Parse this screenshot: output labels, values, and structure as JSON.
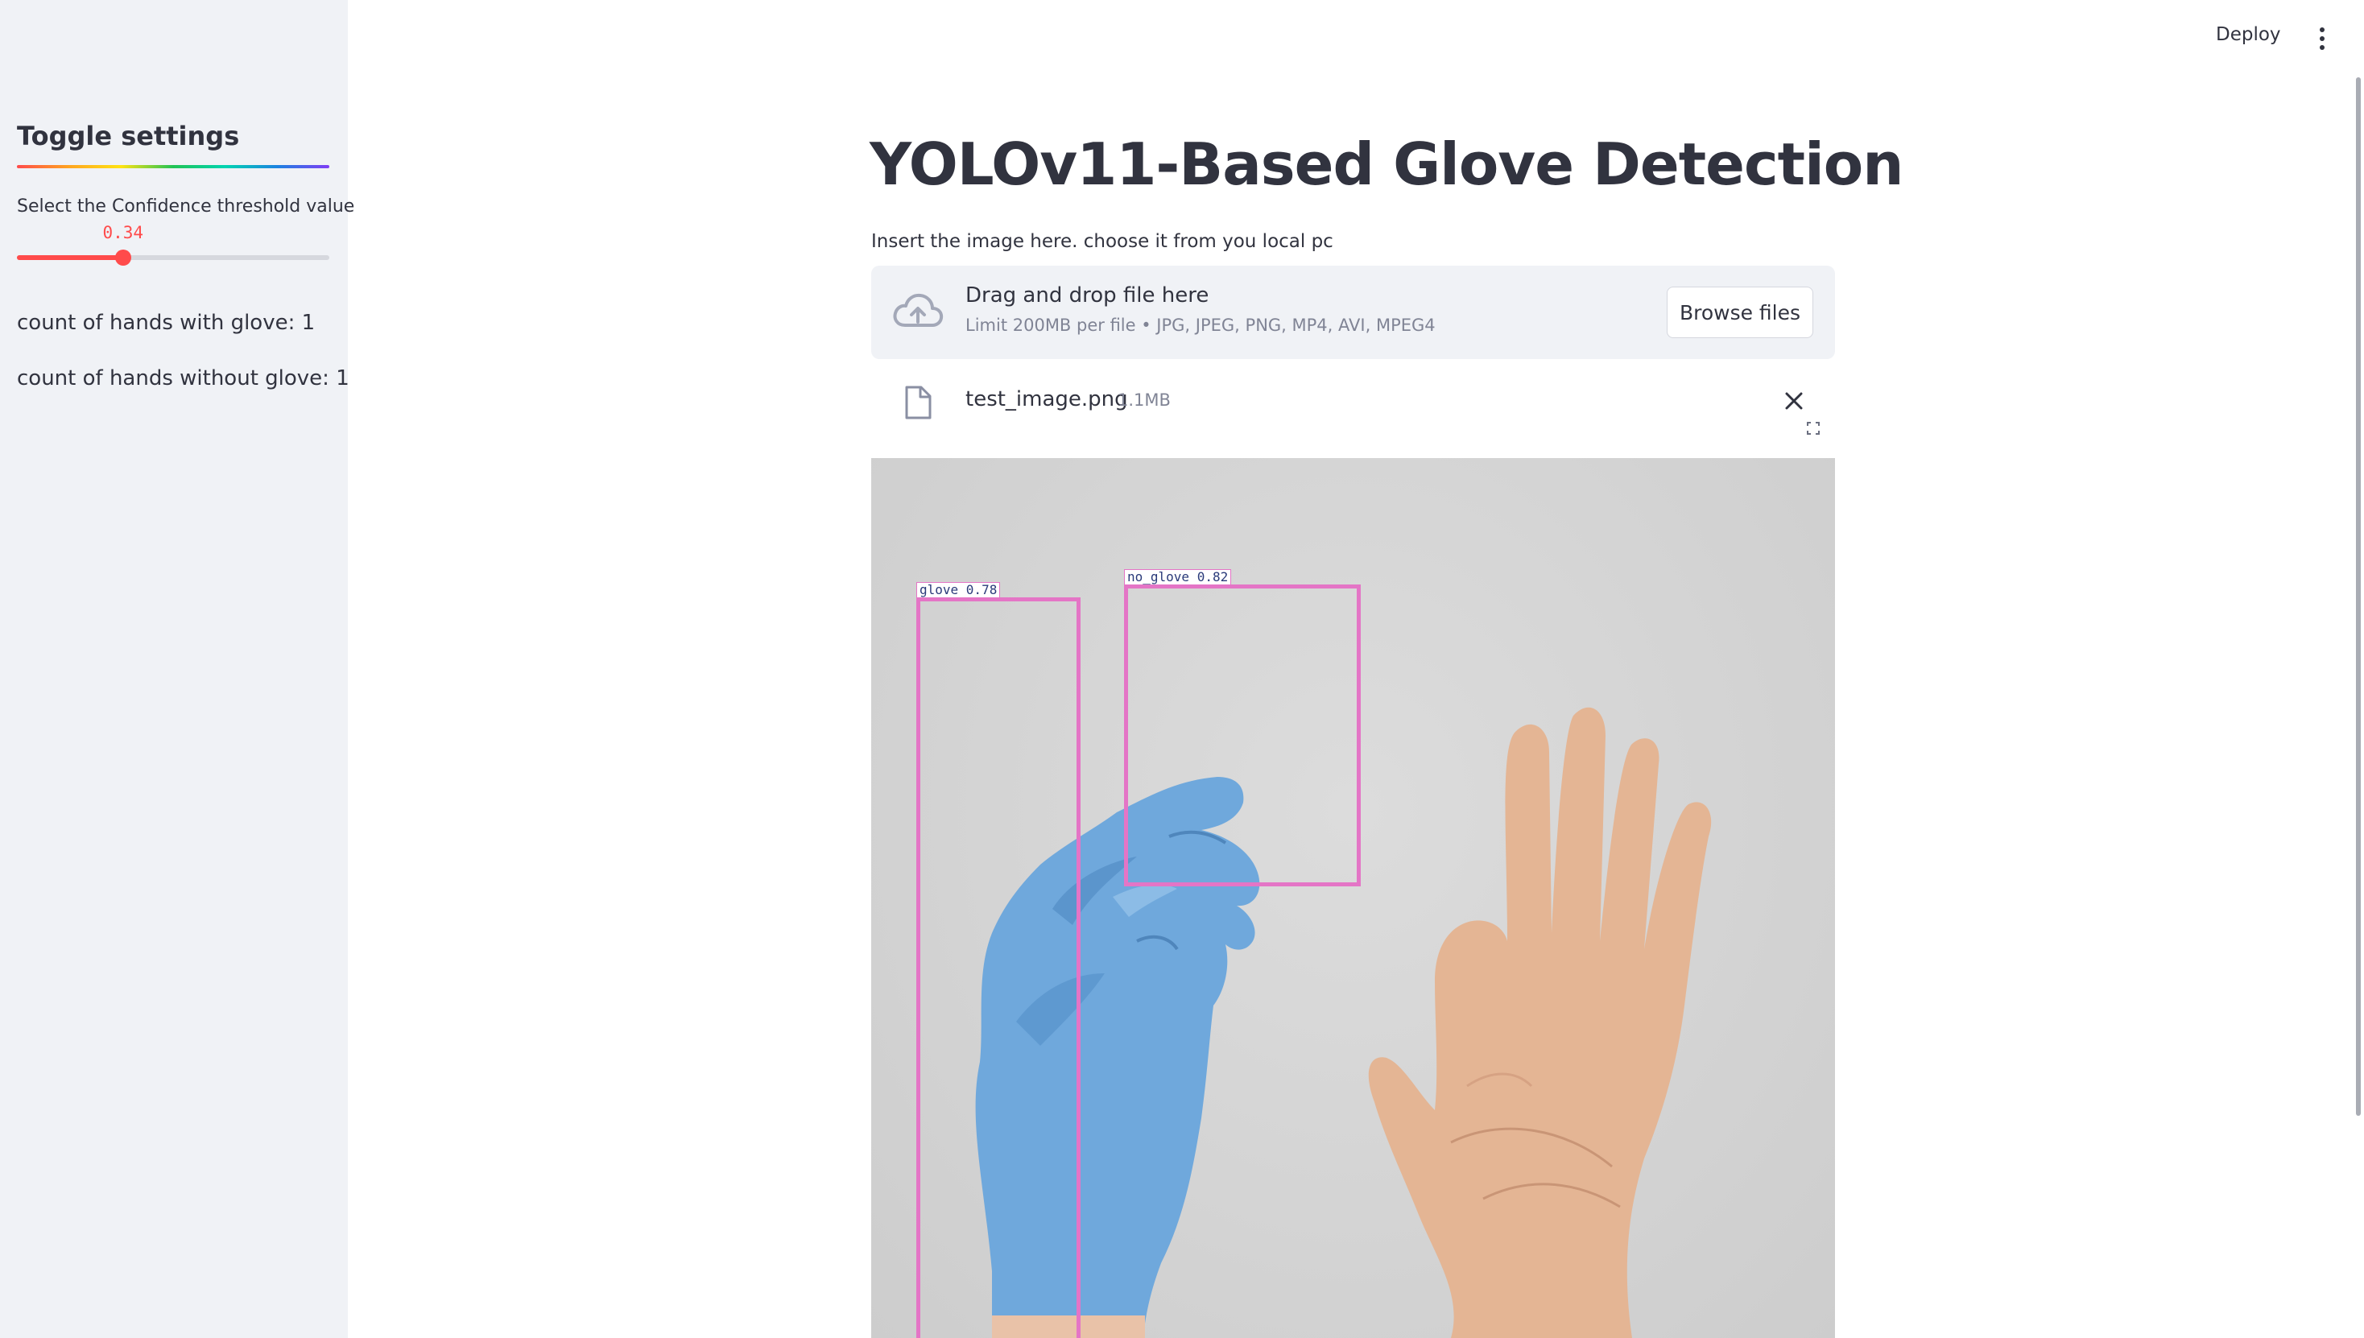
{
  "header": {
    "deploy_label": "Deploy",
    "menu_icon": "kebab-menu-icon"
  },
  "sidebar": {
    "title": "Toggle settings",
    "slider": {
      "label": "Select the Confidence threshold value",
      "value": "0.34",
      "min": 0,
      "max": 1,
      "accent_color": "#ff4b4b"
    },
    "counts": {
      "with_glove": "count of hands with glove: 1",
      "without_glove": "count of hands without glove: 1"
    }
  },
  "main": {
    "title": "YOLOv11-Based Glove Detection",
    "uploader": {
      "label": "Insert the image here. choose it from you local pc",
      "drop_title": "Drag and drop file here",
      "limit_text": "Limit 200MB per file • JPG, JPEG, PNG, MP4, AVI, MPEG4",
      "browse_label": "Browse files",
      "icon": "cloud-upload-icon"
    },
    "file": {
      "name": "test_image.png",
      "size": "1.1MB",
      "icon": "file-icon"
    },
    "detections": [
      {
        "label": "glove 0.78",
        "class": "glove",
        "confidence": 0.78
      },
      {
        "label": "no_glove 0.82",
        "class": "no_glove",
        "confidence": 0.82
      }
    ],
    "bbox_color": "#e475c6"
  }
}
